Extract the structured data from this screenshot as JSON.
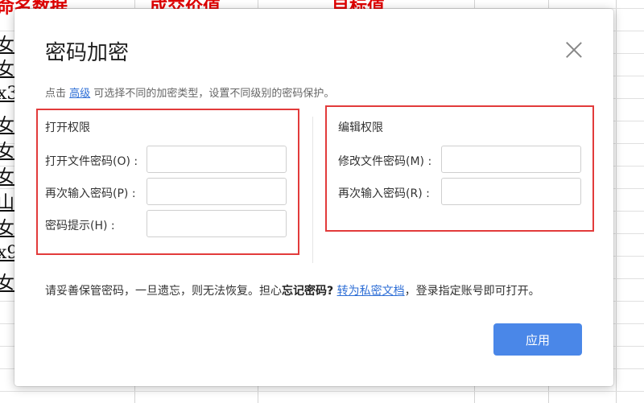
{
  "background_sheet": {
    "headers": [
      "命名数据",
      "成交价值",
      "目标值"
    ],
    "row_glyphs": [
      "女",
      "女",
      "x3",
      "女",
      "女",
      "女",
      "山",
      "女",
      "x9",
      "女"
    ]
  },
  "dialog": {
    "title": "密码加密",
    "hint_prefix": "点击",
    "hint_link": "高级",
    "hint_suffix": "可选择不同的加密类型，设置不同级别的密码保护。",
    "open_perm": {
      "title": "打开权限",
      "open_password_label": "打开文件密码(O) :",
      "confirm_password_label": "再次输入密码(P) :",
      "password_hint_label": "密码提示(H) :",
      "open_password_value": "",
      "confirm_password_value": "",
      "password_hint_value": ""
    },
    "edit_perm": {
      "title": "编辑权限",
      "modify_password_label": "修改文件密码(M) :",
      "confirm_password_label": "再次输入密码(R) :",
      "modify_password_value": "",
      "confirm_password_value": ""
    },
    "notice_prefix": "请妥善保管密码，一旦遗忘，则无法恢复。担心",
    "notice_bold": "忘记密码?",
    "notice_link": "转为私密文档",
    "notice_suffix": "，登录指定账号即可打开。",
    "apply_label": "应用"
  },
  "colors": {
    "accent": "#4a87e8",
    "link": "#2f6fd6",
    "highlight_box": "#e23b3b",
    "sheet_header": "#e00000"
  }
}
